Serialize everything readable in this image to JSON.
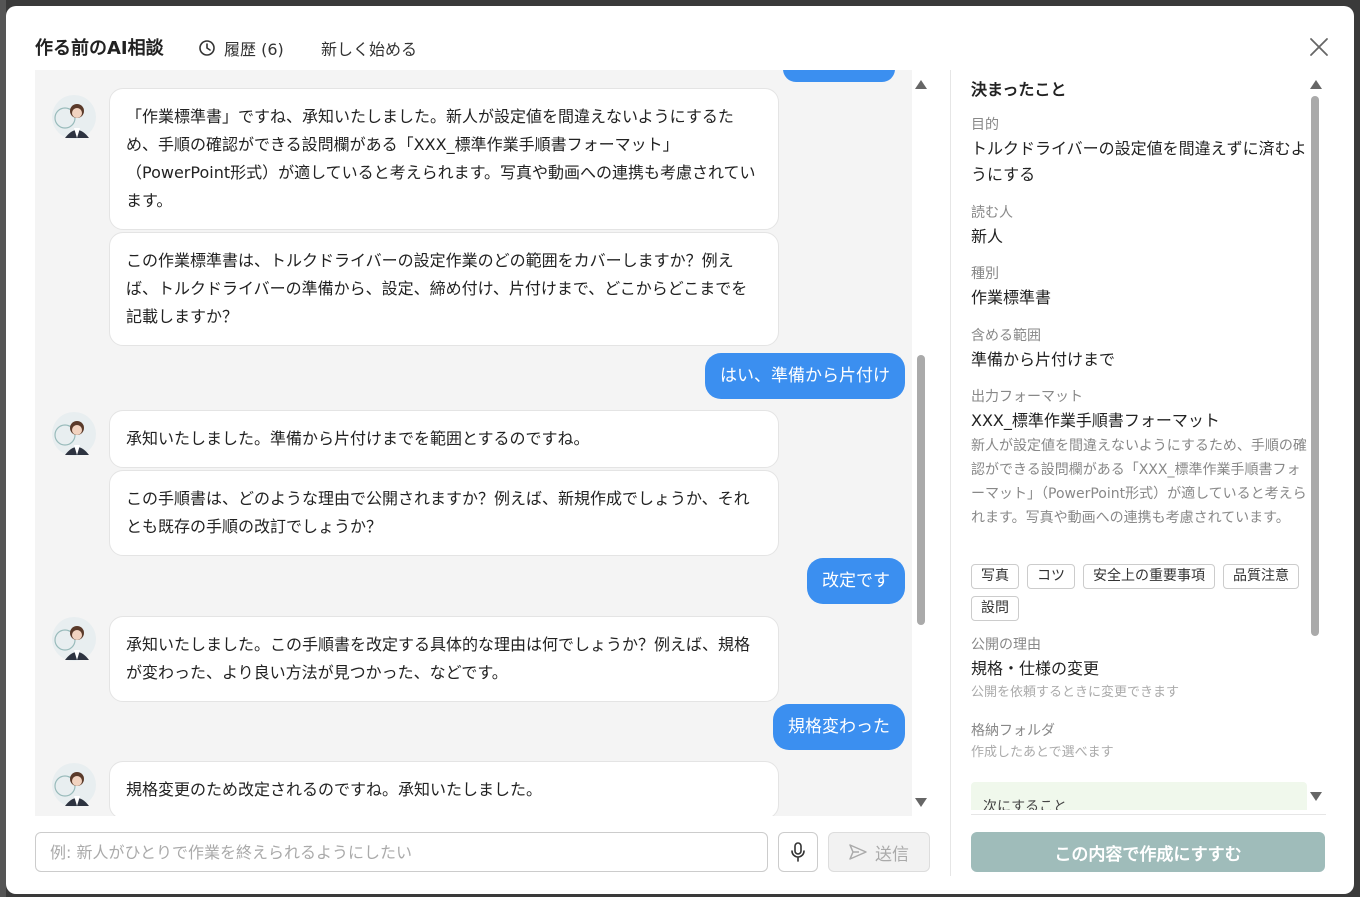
{
  "header": {
    "title": "作る前のAI相談",
    "history_label": "履歴 (6)",
    "new_start_label": "新しく始める"
  },
  "chat": {
    "messages": [
      {
        "role": "ai",
        "text": "「作業標準書」ですね、承知いたしました。新人が設定値を間違えないようにするため、手順の確認ができる設問欄がある「XXX_標準作業手順書フォーマット」（PowerPoint形式）が適していると考えられます。写真や動画への連携も考慮されています。"
      },
      {
        "role": "ai",
        "text": "この作業標準書は、トルクドライバーの設定作業のどの範囲をカバーしますか？例えば、トルクドライバーの準備から、設定、締め付け、片付けまで、どこからどこまでを記載しますか？"
      },
      {
        "role": "user",
        "text": "はい、準備から片付け"
      },
      {
        "role": "ai",
        "text": "承知いたしました。準備から片付けまでを範囲とするのですね。"
      },
      {
        "role": "ai",
        "text": "この手順書は、どのような理由で公開されますか？例えば、新規作成でしょうか、それとも既存の手順の改訂でしょうか？"
      },
      {
        "role": "user",
        "text": "改定です"
      },
      {
        "role": "ai",
        "text": "承知いたしました。この手順書を改定する具体的な理由は何でしょうか？例えば、規格が変わった、より良い方法が見つかった、などです。"
      },
      {
        "role": "user",
        "text": "規格変わった"
      },
      {
        "role": "ai",
        "text": "規格変更のため改定されるのですね。承知いたしました。"
      }
    ]
  },
  "input": {
    "placeholder": "例: 新人がひとりで作業を終えられるようにしたい",
    "send_label": "送信"
  },
  "side": {
    "heading": "決まったこと",
    "purpose": {
      "label": "目的",
      "value": "トルクドライバーの設定値を間違えずに済むようにする"
    },
    "reader": {
      "label": "読む人",
      "value": "新人"
    },
    "kind": {
      "label": "種別",
      "value": "作業標準書"
    },
    "scope": {
      "label": "含める範囲",
      "value": "準備から片付けまで"
    },
    "format": {
      "label": "出力フォーマット",
      "value": "XXX_標準作業手順書フォーマット",
      "note": "新人が設定値を間違えないようにするため、手順の確認ができる設問欄がある「XXX_標準作業手順書フォーマット」（PowerPoint形式）が適していると考えられます。写真や動画への連携も考慮されています。",
      "tags": [
        "写真",
        "コツ",
        "安全上の重要事項",
        "品質注意",
        "設問"
      ]
    },
    "reason": {
      "label": "公開の理由",
      "value": "規格・仕様の変更",
      "hint": "公開を依頼するときに変更できます"
    },
    "folder": {
      "label": "格納フォルダ",
      "hint": "作成したあとで選べます"
    },
    "next_label": "次にすること",
    "create_label": "この内容で作成にすすむ"
  },
  "colors": {
    "user_bubble": "#3b8ff0",
    "create_button": "#9fbcba"
  }
}
